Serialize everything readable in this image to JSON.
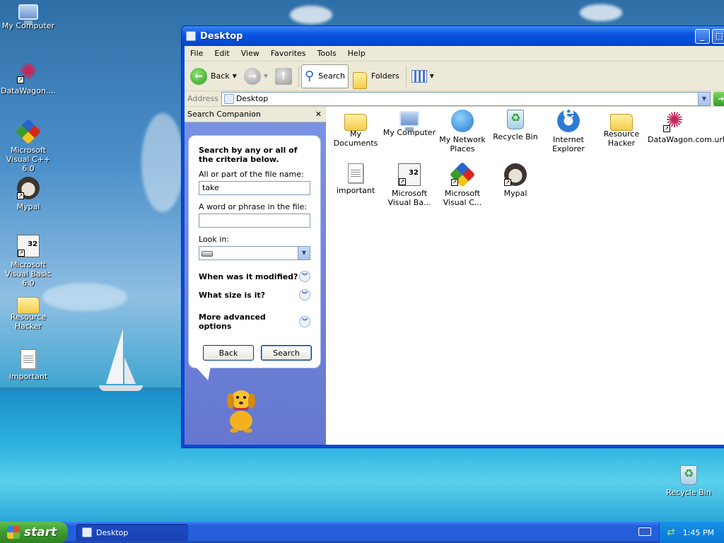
{
  "desktop": {
    "icons": [
      {
        "label": "My Computer",
        "icon": "my-computer-icon"
      },
      {
        "label": "DataWagon....",
        "icon": "datawagon-icon"
      },
      {
        "label": "Microsoft Visual C++ 6.0",
        "icon": "visual-cpp-icon"
      },
      {
        "label": "Mypal",
        "icon": "mypal-icon"
      },
      {
        "label": "Microsoft Visual Basic 6.0",
        "icon": "visual-basic-icon"
      },
      {
        "label": "Resource Hacker",
        "icon": "folder-icon"
      },
      {
        "label": "important",
        "icon": "text-document-icon"
      },
      {
        "label": "Recycle Bin",
        "icon": "recycle-bin-icon"
      }
    ]
  },
  "window": {
    "title": "Desktop",
    "menu": [
      "File",
      "Edit",
      "View",
      "Favorites",
      "Tools",
      "Help"
    ],
    "toolbar": {
      "back": "Back",
      "search": "Search",
      "folders": "Folders"
    },
    "address": {
      "label": "Address",
      "value": "Desktop"
    },
    "search_companion": {
      "header": "Search Companion",
      "close": "✕",
      "intro": "Search by any or all of the criteria below.",
      "name_label": "All or part of the file name:",
      "name_value": "take",
      "phrase_label": "A word or phrase in the file:",
      "phrase_value": "",
      "look_in_label": "Look in:",
      "modified": "When was it modified?",
      "size": "What size is it?",
      "advanced": "More advanced options",
      "back_button": "Back",
      "search_button": "Search"
    },
    "files": [
      {
        "label": "My Documents",
        "icon": "my-documents-icon"
      },
      {
        "label": "My Computer",
        "icon": "my-computer-icon"
      },
      {
        "label": "My Network Places",
        "icon": "network-places-icon"
      },
      {
        "label": "Recycle Bin",
        "icon": "recycle-bin-icon"
      },
      {
        "label": "Internet Explorer",
        "icon": "internet-explorer-icon"
      },
      {
        "label": "Resource Hacker",
        "icon": "folder-icon"
      },
      {
        "label": "DataWagon.com.url",
        "icon": "datawagon-icon"
      },
      {
        "label": "important",
        "icon": "text-document-icon"
      },
      {
        "label": "Microsoft Visual Ba...",
        "icon": "visual-basic-icon"
      },
      {
        "label": "Microsoft Visual C...",
        "icon": "visual-cpp-icon"
      },
      {
        "label": "Mypal",
        "icon": "mypal-icon"
      }
    ]
  },
  "taskbar": {
    "start": "start",
    "task": "Desktop",
    "clock": "1:45 PM"
  }
}
